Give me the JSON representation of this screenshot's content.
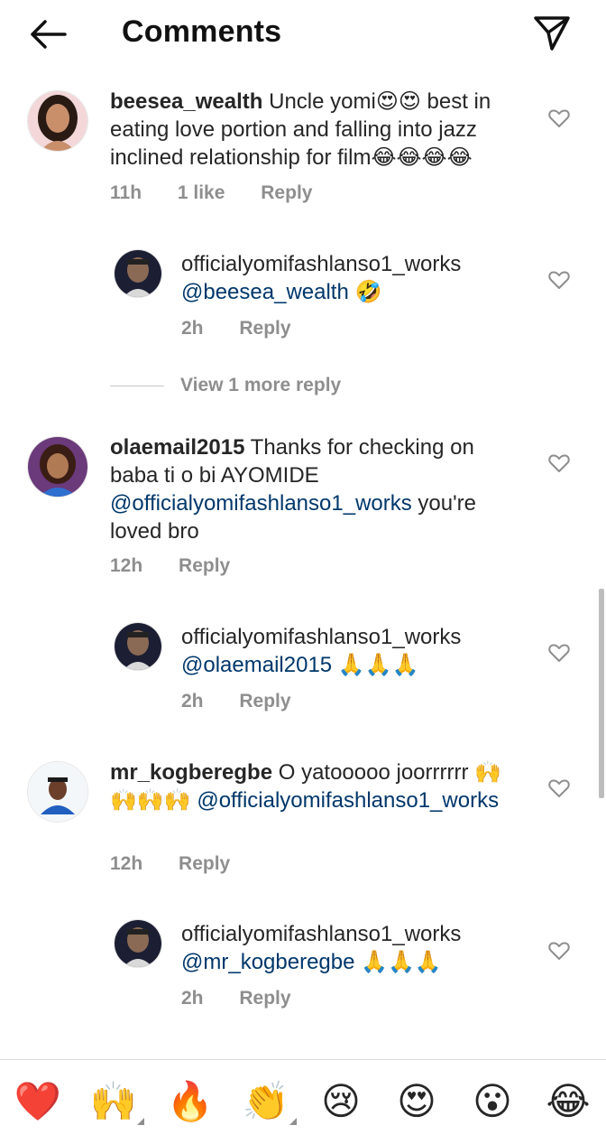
{
  "header": {
    "title": "Comments"
  },
  "comments": [
    {
      "username": "beesea_wealth",
      "text_before": "Uncle yomi",
      "emoji1": "😍😍",
      "text_after": " best in eating love portion and falling into jazz inclined relationship for film",
      "emoji2": "😂😂😂😂",
      "time": "11h",
      "likes": "1 like",
      "reply": "Reply"
    },
    {
      "username": "officialyomifashlanso1_works",
      "mention": "@beesea_wealth",
      "emoji": "🤣",
      "time": "2h",
      "reply": "Reply"
    },
    {
      "username": "olaemail2015",
      "text_before": "Thanks for checking on baba ti o bi AYOMIDE",
      "mention": "@officialyomifashlanso1_works",
      "text_after": " you're loved bro",
      "time": "12h",
      "reply": "Reply"
    },
    {
      "username": "officialyomifashlanso1_works",
      "mention": "@olaemail2015",
      "emoji": "🙏🙏🙏",
      "time": "2h",
      "reply": "Reply"
    },
    {
      "username": "mr_kogberegbe",
      "text_before": "O yatooooo joorrrrrr",
      "emoji": "🙌🙌🙌🙌",
      "mention": "@officialyomifashlanso1_works",
      "time": "12h",
      "reply": "Reply"
    },
    {
      "username": "officialyomifashlanso1_works",
      "mention": "@mr_kogberegbe",
      "emoji": "🙏🙏🙏",
      "time": "2h",
      "reply": "Reply"
    }
  ],
  "view_more": "View 1 more reply",
  "emoji_bar": [
    "❤️",
    "🙌",
    "🔥",
    "👏",
    "😢",
    "😍",
    "😮",
    "😂"
  ],
  "colors": {
    "mention": "#00376b",
    "meta": "#8e8e8e",
    "text": "#262626"
  },
  "icons": [
    "back-arrow-icon",
    "send-icon",
    "heart-outline-icon"
  ]
}
